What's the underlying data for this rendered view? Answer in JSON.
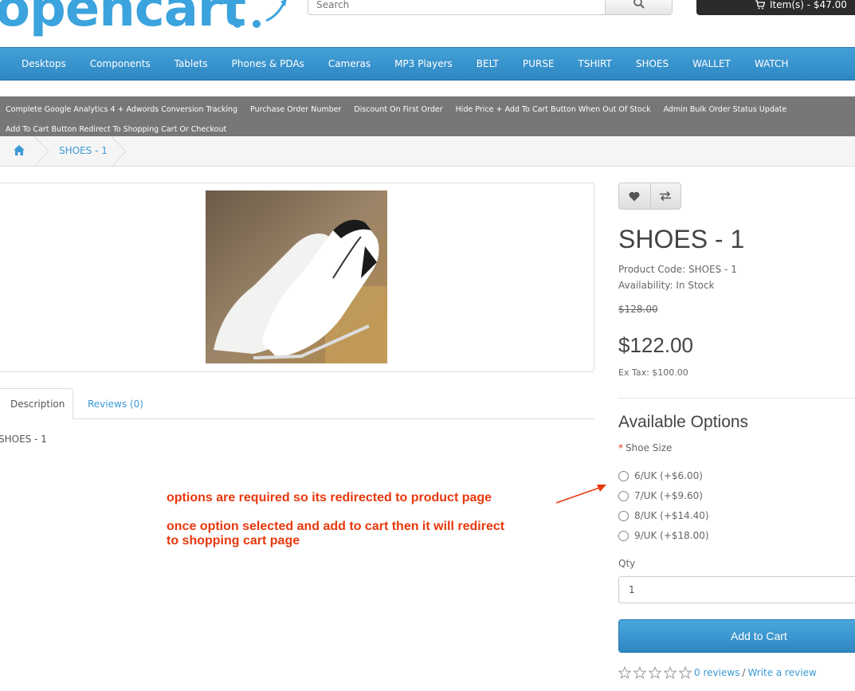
{
  "header": {
    "logo_text": "opencart",
    "search": {
      "placeholder": "Search"
    },
    "cart_label": "Item(s) - $47.00"
  },
  "menu": [
    "Desktops",
    "Components",
    "Tablets",
    "Phones & PDAs",
    "Cameras",
    "MP3 Players",
    "BELT",
    "PURSE",
    "TSHIRT",
    "SHOES",
    "WALLET",
    "WATCH"
  ],
  "extension_links": [
    "Complete Google Analytics 4 + Adwords Conversion Tracking",
    "Purchase Order Number",
    "Discount On First Order",
    "Hide Price + Add To Cart Button When Out Of Stock",
    "Admin Bulk Order Status Update",
    "Add To Cart Button Redirect To Shopping Cart Or Checkout"
  ],
  "breadcrumb": {
    "current": "SHOES - 1"
  },
  "tabs": {
    "description": "Description",
    "reviews": "Reviews (0)"
  },
  "description_text": "SHOES - 1",
  "annotation": {
    "line1": "options are required so its redirected to product page",
    "line2a": "once option selected and add to cart then it will redirect",
    "line2b": "to shopping cart page"
  },
  "product": {
    "title": "SHOES - 1",
    "code": "Product Code: SHOES - 1",
    "availability": "Availability: In Stock",
    "old_price": "$128.00",
    "price": "$122.00",
    "ex_tax": "Ex Tax: $100.00"
  },
  "options": {
    "title": "Available Options",
    "required_marker": "*",
    "label": "Shoe Size",
    "items": [
      "6/UK (+$6.00)",
      "7/UK (+$9.60)",
      "8/UK (+$14.40)",
      "9/UK (+$18.00)"
    ]
  },
  "qty": {
    "label": "Qty",
    "value": "1"
  },
  "add_to_cart_label": "Add to Cart",
  "rating": {
    "stars": 0,
    "max": 5,
    "reviews_link": "0 reviews",
    "separator": "/",
    "write_link": "Write a review"
  },
  "colors": {
    "accent": "#3a9ad6",
    "annotation": "#e8380d",
    "menu_bg": "#2f88c4",
    "ext_bar_bg": "#777777"
  }
}
